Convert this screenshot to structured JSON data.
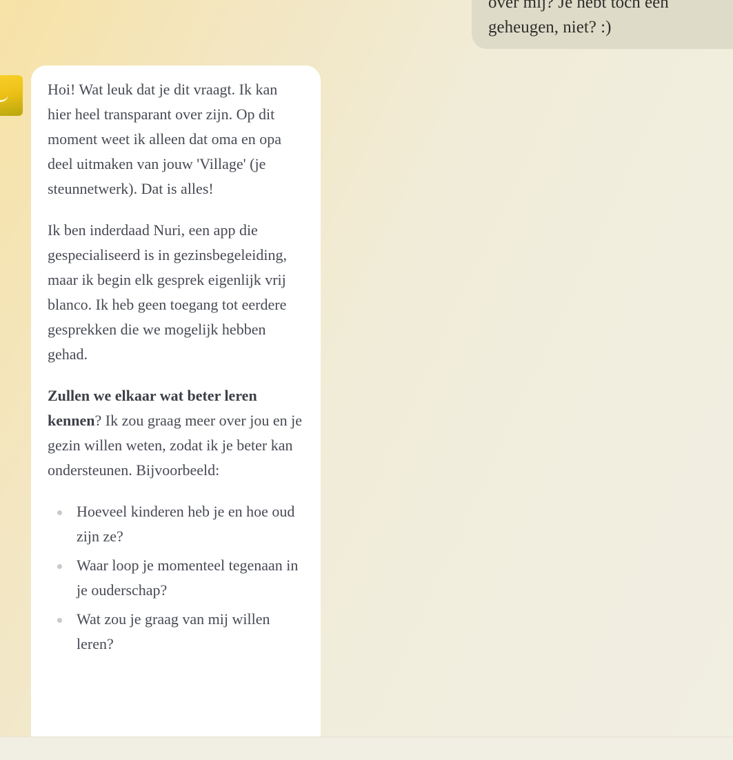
{
  "user_message": {
    "line1": "over mij? Je hebt toch een",
    "line2": "geheugen, niet? :)"
  },
  "assistant": {
    "avatar_icon": "nuri-smiley-avatar",
    "paragraph1": "Hoi! Wat leuk dat je dit vraagt. Ik kan hier heel transparant over zijn. Op dit moment weet ik alleen dat oma en opa deel uitmaken van jouw 'Village' (je steunnetwerk). Dat is alles!",
    "paragraph2": "Ik ben inderdaad Nuri, een app die gespecialiseerd is in gezinsbegeleiding, maar ik begin elk gesprek eigenlijk vrij blanco. Ik heb geen toegang tot eerdere gesprekken die we mogelijk hebben gehad.",
    "paragraph3_bold": "Zullen we elkaar wat beter leren kennen",
    "paragraph3_rest": "? Ik zou graag meer over jou en je gezin willen weten, zodat ik je beter kan ondersteunen. Bijvoorbeeld:",
    "questions": [
      "Hoeveel kinderen heb je en hoe oud zijn ze?",
      "Waar loop je momenteel tegenaan in je ouderschap?",
      "Wat zou je graag van mij willen leren?"
    ]
  },
  "colors": {
    "user_bubble": "#dedcc9",
    "assistant_bubble": "#ffffff",
    "avatar_yellow": "#f2c51f",
    "text": "#474a53"
  }
}
